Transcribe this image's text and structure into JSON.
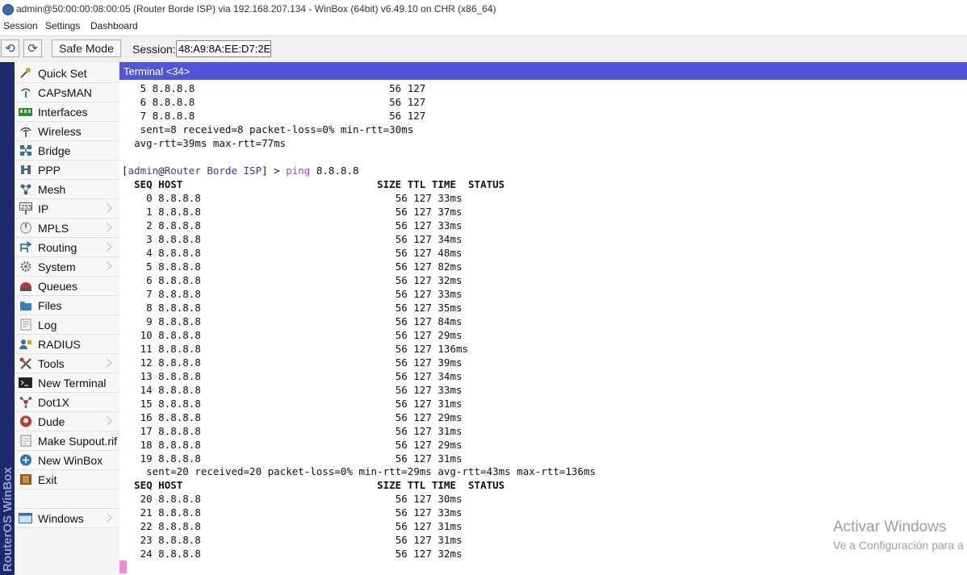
{
  "window": {
    "title": "admin@50:00:00:08:00:05 (Router Borde ISP) via 192.168.207.134 - WinBox (64bit) v6.49.10 on CHR (x86_64)"
  },
  "menu": {
    "session": "Session",
    "settings": "Settings",
    "dashboard": "Dashboard"
  },
  "toolbar": {
    "undo_glyph": "⟲",
    "redo_glyph": "⟳",
    "safe_mode": "Safe Mode",
    "session_label": "Session:",
    "session_value": "48:A9:8A:EE:D7:2E"
  },
  "brand": {
    "vertical_text": "RouterOS WinBox",
    "bar_color": "#1b2a6b"
  },
  "sidebar": {
    "items": [
      {
        "label": "Quick Set",
        "icon": "quick-set-icon",
        "submenu": false
      },
      {
        "label": "CAPsMAN",
        "icon": "capsman-icon",
        "submenu": false
      },
      {
        "label": "Interfaces",
        "icon": "interfaces-icon",
        "submenu": false
      },
      {
        "label": "Wireless",
        "icon": "wireless-icon",
        "submenu": false
      },
      {
        "label": "Bridge",
        "icon": "bridge-icon",
        "submenu": false
      },
      {
        "label": "PPP",
        "icon": "ppp-icon",
        "submenu": false
      },
      {
        "label": "Mesh",
        "icon": "mesh-icon",
        "submenu": false
      },
      {
        "label": "IP",
        "icon": "ip-icon",
        "submenu": true
      },
      {
        "label": "MPLS",
        "icon": "mpls-icon",
        "submenu": true
      },
      {
        "label": "Routing",
        "icon": "routing-icon",
        "submenu": true
      },
      {
        "label": "System",
        "icon": "system-icon",
        "submenu": true
      },
      {
        "label": "Queues",
        "icon": "queues-icon",
        "submenu": false
      },
      {
        "label": "Files",
        "icon": "files-icon",
        "submenu": false
      },
      {
        "label": "Log",
        "icon": "log-icon",
        "submenu": false
      },
      {
        "label": "RADIUS",
        "icon": "radius-icon",
        "submenu": false
      },
      {
        "label": "Tools",
        "icon": "tools-icon",
        "submenu": true
      },
      {
        "label": "New Terminal",
        "icon": "new-terminal-icon",
        "submenu": false
      },
      {
        "label": "Dot1X",
        "icon": "dot1x-icon",
        "submenu": false
      },
      {
        "label": "Dude",
        "icon": "dude-icon",
        "submenu": true
      },
      {
        "label": "Make Supout.rif",
        "icon": "make-supout-icon",
        "submenu": false
      },
      {
        "label": "New WinBox",
        "icon": "new-winbox-icon",
        "submenu": false
      },
      {
        "label": "Exit",
        "icon": "exit-icon",
        "submenu": false
      }
    ],
    "windows": {
      "label": "Windows",
      "icon": "windows-icon",
      "submenu": true
    }
  },
  "terminal": {
    "title": "Terminal <34>",
    "prev_rows": [
      {
        "seq": "5",
        "host": "8.8.8.8",
        "size": "56",
        "ttl": "127"
      },
      {
        "seq": "6",
        "host": "8.8.8.8",
        "size": "56",
        "ttl": "127"
      },
      {
        "seq": "7",
        "host": "8.8.8.8",
        "size": "56",
        "ttl": "127"
      }
    ],
    "prev_summary_1": "sent=8 received=8 packet-loss=0% min-rtt=30ms",
    "prev_summary_2": "avg-rtt=39ms max-rtt=77ms",
    "prompt_user": "admin",
    "prompt_host": "Router Borde ISP",
    "prompt_symbol": "] >",
    "command": "ping",
    "command_arg": "8.8.8.8",
    "headers": {
      "seq": "SEQ",
      "host": "HOST",
      "size": "SIZE",
      "ttl": "TTL",
      "time": "TIME",
      "status": "STATUS"
    },
    "rows": [
      {
        "seq": "0",
        "host": "8.8.8.8",
        "size": "56",
        "ttl": "127",
        "time": "33ms"
      },
      {
        "seq": "1",
        "host": "8.8.8.8",
        "size": "56",
        "ttl": "127",
        "time": "37ms"
      },
      {
        "seq": "2",
        "host": "8.8.8.8",
        "size": "56",
        "ttl": "127",
        "time": "33ms"
      },
      {
        "seq": "3",
        "host": "8.8.8.8",
        "size": "56",
        "ttl": "127",
        "time": "34ms"
      },
      {
        "seq": "4",
        "host": "8.8.8.8",
        "size": "56",
        "ttl": "127",
        "time": "48ms"
      },
      {
        "seq": "5",
        "host": "8.8.8.8",
        "size": "56",
        "ttl": "127",
        "time": "82ms"
      },
      {
        "seq": "6",
        "host": "8.8.8.8",
        "size": "56",
        "ttl": "127",
        "time": "32ms"
      },
      {
        "seq": "7",
        "host": "8.8.8.8",
        "size": "56",
        "ttl": "127",
        "time": "33ms"
      },
      {
        "seq": "8",
        "host": "8.8.8.8",
        "size": "56",
        "ttl": "127",
        "time": "35ms"
      },
      {
        "seq": "9",
        "host": "8.8.8.8",
        "size": "56",
        "ttl": "127",
        "time": "84ms"
      },
      {
        "seq": "10",
        "host": "8.8.8.8",
        "size": "56",
        "ttl": "127",
        "time": "29ms"
      },
      {
        "seq": "11",
        "host": "8.8.8.8",
        "size": "56",
        "ttl": "127",
        "time": "136ms"
      },
      {
        "seq": "12",
        "host": "8.8.8.8",
        "size": "56",
        "ttl": "127",
        "time": "39ms"
      },
      {
        "seq": "13",
        "host": "8.8.8.8",
        "size": "56",
        "ttl": "127",
        "time": "34ms"
      },
      {
        "seq": "14",
        "host": "8.8.8.8",
        "size": "56",
        "ttl": "127",
        "time": "33ms"
      },
      {
        "seq": "15",
        "host": "8.8.8.8",
        "size": "56",
        "ttl": "127",
        "time": "31ms"
      },
      {
        "seq": "16",
        "host": "8.8.8.8",
        "size": "56",
        "ttl": "127",
        "time": "29ms"
      },
      {
        "seq": "17",
        "host": "8.8.8.8",
        "size": "56",
        "ttl": "127",
        "time": "31ms"
      },
      {
        "seq": "18",
        "host": "8.8.8.8",
        "size": "56",
        "ttl": "127",
        "time": "29ms"
      },
      {
        "seq": "19",
        "host": "8.8.8.8",
        "size": "56",
        "ttl": "127",
        "time": "31ms"
      }
    ],
    "summary": "sent=20 received=20 packet-loss=0% min-rtt=29ms avg-rtt=43ms max-rtt=136ms",
    "rows2": [
      {
        "seq": "20",
        "host": "8.8.8.8",
        "size": "56",
        "ttl": "127",
        "time": "30ms"
      },
      {
        "seq": "21",
        "host": "8.8.8.8",
        "size": "56",
        "ttl": "127",
        "time": "33ms"
      },
      {
        "seq": "22",
        "host": "8.8.8.8",
        "size": "56",
        "ttl": "127",
        "time": "31ms"
      },
      {
        "seq": "23",
        "host": "8.8.8.8",
        "size": "56",
        "ttl": "127",
        "time": "31ms"
      },
      {
        "seq": "24",
        "host": "8.8.8.8",
        "size": "56",
        "ttl": "127",
        "time": "32ms"
      }
    ],
    "colors": {
      "header_bg": "#5056d9",
      "summary": "#1e9a1e",
      "prompt_user": "#2b3db5",
      "command": "#b93cc8",
      "cursor": "#f08ad2"
    }
  },
  "watermark": {
    "line1": "Activar Windows",
    "line2": "Ve a Configuración para a"
  }
}
